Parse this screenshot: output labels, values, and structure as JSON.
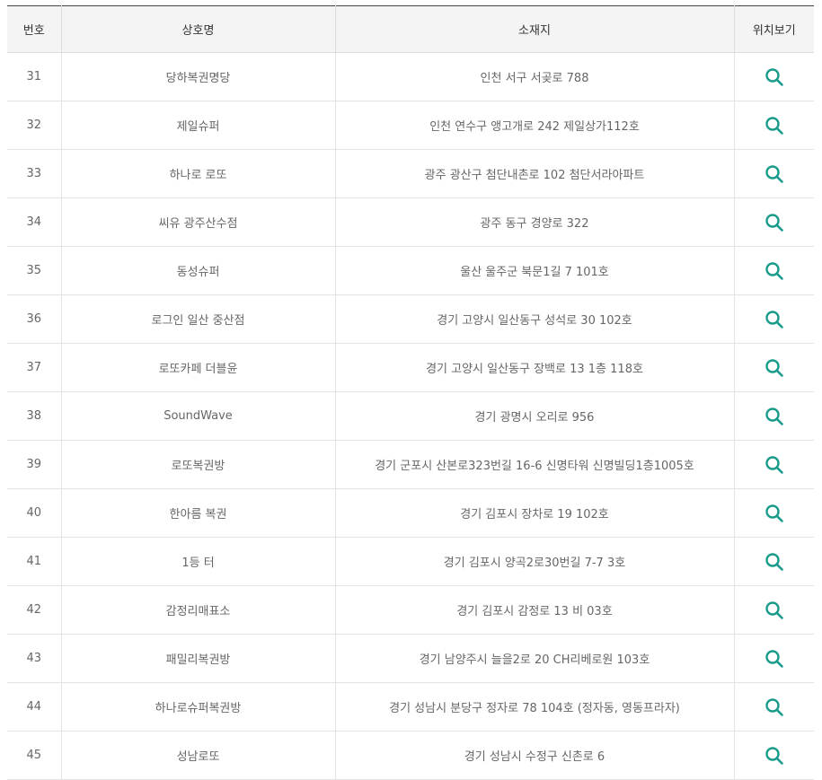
{
  "colors": {
    "accent": "#1a9b8b",
    "header_bg": "#f4f4f4",
    "border": "#e3e3e3"
  },
  "table": {
    "headers": {
      "no": "번호",
      "name": "상호명",
      "address": "소재지",
      "location": "위치보기"
    },
    "location_icon": "search-icon",
    "rows": [
      {
        "no": "31",
        "name": "당하복권명당",
        "address": "인천 서구 서곶로 788"
      },
      {
        "no": "32",
        "name": "제일슈퍼",
        "address": "인천 연수구 앵고개로 242 제일상가112호"
      },
      {
        "no": "33",
        "name": "하나로 로또",
        "address": "광주 광산구 첨단내촌로 102 첨단서라아파트"
      },
      {
        "no": "34",
        "name": "씨유 광주산수점",
        "address": "광주 동구 경양로 322"
      },
      {
        "no": "35",
        "name": "동성슈퍼",
        "address": "울산 울주군 북문1길 7 101호"
      },
      {
        "no": "36",
        "name": "로그인 일산 중산점",
        "address": "경기 고양시 일산동구 성석로 30 102호"
      },
      {
        "no": "37",
        "name": "로또카페 더블윤",
        "address": "경기 고양시 일산동구 장백로 13 1층 118호"
      },
      {
        "no": "38",
        "name": "SoundWave",
        "address": "경기 광명시 오리로 956"
      },
      {
        "no": "39",
        "name": "로또복권방",
        "address": "경기 군포시 산본로323번길 16-6 신명타워 신명빌딩1층1005호"
      },
      {
        "no": "40",
        "name": "한아름 복권",
        "address": "경기 김포시 장차로 19 102호"
      },
      {
        "no": "41",
        "name": "1등 터",
        "address": "경기 김포시 양곡2로30번길 7-7 3호"
      },
      {
        "no": "42",
        "name": "감정리매표소",
        "address": "경기 김포시 감정로 13 비 03호"
      },
      {
        "no": "43",
        "name": "패밀리복권방",
        "address": "경기 남양주시 늘을2로 20 CH리베로원 103호"
      },
      {
        "no": "44",
        "name": "하나로슈퍼복권방",
        "address": "경기 성남시 분당구 정자로 78 104호 (정자동, 영동프라자)"
      },
      {
        "no": "45",
        "name": "성남로또",
        "address": "경기 성남시 수정구 신촌로 6"
      }
    ]
  }
}
